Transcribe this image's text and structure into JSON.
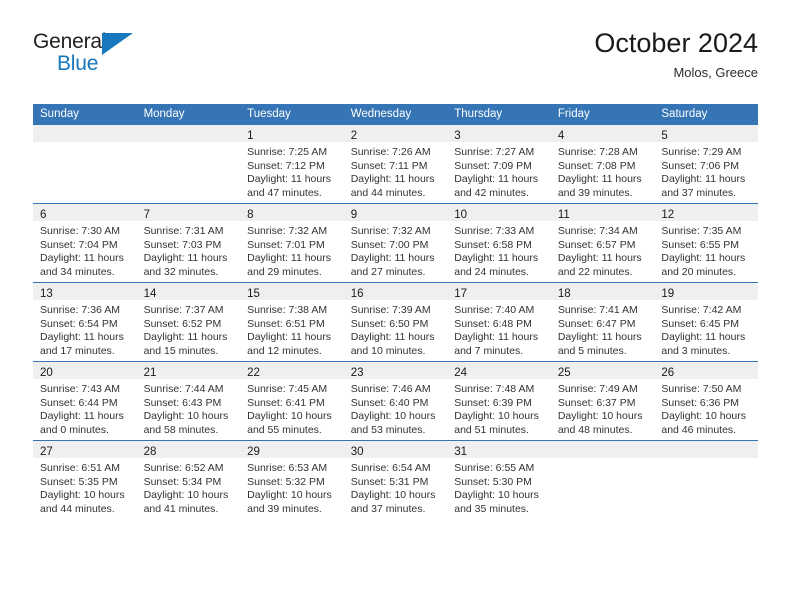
{
  "logo": {
    "word_one": "General",
    "word_two": "Blue",
    "flag_icon": "blue-triangle-flag-icon",
    "brand_color": "#1878be"
  },
  "header": {
    "title": "October 2024",
    "subtitle": "Molos, Greece"
  },
  "theme": {
    "header_row_bg": "#3574b5",
    "daynum_strip_bg": "#efefef",
    "separator_color": "#3574b5",
    "text_color": "#333333"
  },
  "calendar": {
    "weekday_headers": [
      "Sunday",
      "Monday",
      "Tuesday",
      "Wednesday",
      "Thursday",
      "Friday",
      "Saturday"
    ],
    "weeks": [
      [
        {
          "day": "",
          "lines": []
        },
        {
          "day": "",
          "lines": []
        },
        {
          "day": "1",
          "lines": [
            "Sunrise: 7:25 AM",
            "Sunset: 7:12 PM",
            "Daylight: 11 hours",
            "and 47 minutes."
          ]
        },
        {
          "day": "2",
          "lines": [
            "Sunrise: 7:26 AM",
            "Sunset: 7:11 PM",
            "Daylight: 11 hours",
            "and 44 minutes."
          ]
        },
        {
          "day": "3",
          "lines": [
            "Sunrise: 7:27 AM",
            "Sunset: 7:09 PM",
            "Daylight: 11 hours",
            "and 42 minutes."
          ]
        },
        {
          "day": "4",
          "lines": [
            "Sunrise: 7:28 AM",
            "Sunset: 7:08 PM",
            "Daylight: 11 hours",
            "and 39 minutes."
          ]
        },
        {
          "day": "5",
          "lines": [
            "Sunrise: 7:29 AM",
            "Sunset: 7:06 PM",
            "Daylight: 11 hours",
            "and 37 minutes."
          ]
        }
      ],
      [
        {
          "day": "6",
          "lines": [
            "Sunrise: 7:30 AM",
            "Sunset: 7:04 PM",
            "Daylight: 11 hours",
            "and 34 minutes."
          ]
        },
        {
          "day": "7",
          "lines": [
            "Sunrise: 7:31 AM",
            "Sunset: 7:03 PM",
            "Daylight: 11 hours",
            "and 32 minutes."
          ]
        },
        {
          "day": "8",
          "lines": [
            "Sunrise: 7:32 AM",
            "Sunset: 7:01 PM",
            "Daylight: 11 hours",
            "and 29 minutes."
          ]
        },
        {
          "day": "9",
          "lines": [
            "Sunrise: 7:32 AM",
            "Sunset: 7:00 PM",
            "Daylight: 11 hours",
            "and 27 minutes."
          ]
        },
        {
          "day": "10",
          "lines": [
            "Sunrise: 7:33 AM",
            "Sunset: 6:58 PM",
            "Daylight: 11 hours",
            "and 24 minutes."
          ]
        },
        {
          "day": "11",
          "lines": [
            "Sunrise: 7:34 AM",
            "Sunset: 6:57 PM",
            "Daylight: 11 hours",
            "and 22 minutes."
          ]
        },
        {
          "day": "12",
          "lines": [
            "Sunrise: 7:35 AM",
            "Sunset: 6:55 PM",
            "Daylight: 11 hours",
            "and 20 minutes."
          ]
        }
      ],
      [
        {
          "day": "13",
          "lines": [
            "Sunrise: 7:36 AM",
            "Sunset: 6:54 PM",
            "Daylight: 11 hours",
            "and 17 minutes."
          ]
        },
        {
          "day": "14",
          "lines": [
            "Sunrise: 7:37 AM",
            "Sunset: 6:52 PM",
            "Daylight: 11 hours",
            "and 15 minutes."
          ]
        },
        {
          "day": "15",
          "lines": [
            "Sunrise: 7:38 AM",
            "Sunset: 6:51 PM",
            "Daylight: 11 hours",
            "and 12 minutes."
          ]
        },
        {
          "day": "16",
          "lines": [
            "Sunrise: 7:39 AM",
            "Sunset: 6:50 PM",
            "Daylight: 11 hours",
            "and 10 minutes."
          ]
        },
        {
          "day": "17",
          "lines": [
            "Sunrise: 7:40 AM",
            "Sunset: 6:48 PM",
            "Daylight: 11 hours",
            "and 7 minutes."
          ]
        },
        {
          "day": "18",
          "lines": [
            "Sunrise: 7:41 AM",
            "Sunset: 6:47 PM",
            "Daylight: 11 hours",
            "and 5 minutes."
          ]
        },
        {
          "day": "19",
          "lines": [
            "Sunrise: 7:42 AM",
            "Sunset: 6:45 PM",
            "Daylight: 11 hours",
            "and 3 minutes."
          ]
        }
      ],
      [
        {
          "day": "20",
          "lines": [
            "Sunrise: 7:43 AM",
            "Sunset: 6:44 PM",
            "Daylight: 11 hours",
            "and 0 minutes."
          ]
        },
        {
          "day": "21",
          "lines": [
            "Sunrise: 7:44 AM",
            "Sunset: 6:43 PM",
            "Daylight: 10 hours",
            "and 58 minutes."
          ]
        },
        {
          "day": "22",
          "lines": [
            "Sunrise: 7:45 AM",
            "Sunset: 6:41 PM",
            "Daylight: 10 hours",
            "and 55 minutes."
          ]
        },
        {
          "day": "23",
          "lines": [
            "Sunrise: 7:46 AM",
            "Sunset: 6:40 PM",
            "Daylight: 10 hours",
            "and 53 minutes."
          ]
        },
        {
          "day": "24",
          "lines": [
            "Sunrise: 7:48 AM",
            "Sunset: 6:39 PM",
            "Daylight: 10 hours",
            "and 51 minutes."
          ]
        },
        {
          "day": "25",
          "lines": [
            "Sunrise: 7:49 AM",
            "Sunset: 6:37 PM",
            "Daylight: 10 hours",
            "and 48 minutes."
          ]
        },
        {
          "day": "26",
          "lines": [
            "Sunrise: 7:50 AM",
            "Sunset: 6:36 PM",
            "Daylight: 10 hours",
            "and 46 minutes."
          ]
        }
      ],
      [
        {
          "day": "27",
          "lines": [
            "Sunrise: 6:51 AM",
            "Sunset: 5:35 PM",
            "Daylight: 10 hours",
            "and 44 minutes."
          ]
        },
        {
          "day": "28",
          "lines": [
            "Sunrise: 6:52 AM",
            "Sunset: 5:34 PM",
            "Daylight: 10 hours",
            "and 41 minutes."
          ]
        },
        {
          "day": "29",
          "lines": [
            "Sunrise: 6:53 AM",
            "Sunset: 5:32 PM",
            "Daylight: 10 hours",
            "and 39 minutes."
          ]
        },
        {
          "day": "30",
          "lines": [
            "Sunrise: 6:54 AM",
            "Sunset: 5:31 PM",
            "Daylight: 10 hours",
            "and 37 minutes."
          ]
        },
        {
          "day": "31",
          "lines": [
            "Sunrise: 6:55 AM",
            "Sunset: 5:30 PM",
            "Daylight: 10 hours",
            "and 35 minutes."
          ]
        },
        {
          "day": "",
          "lines": []
        },
        {
          "day": "",
          "lines": []
        }
      ]
    ]
  }
}
